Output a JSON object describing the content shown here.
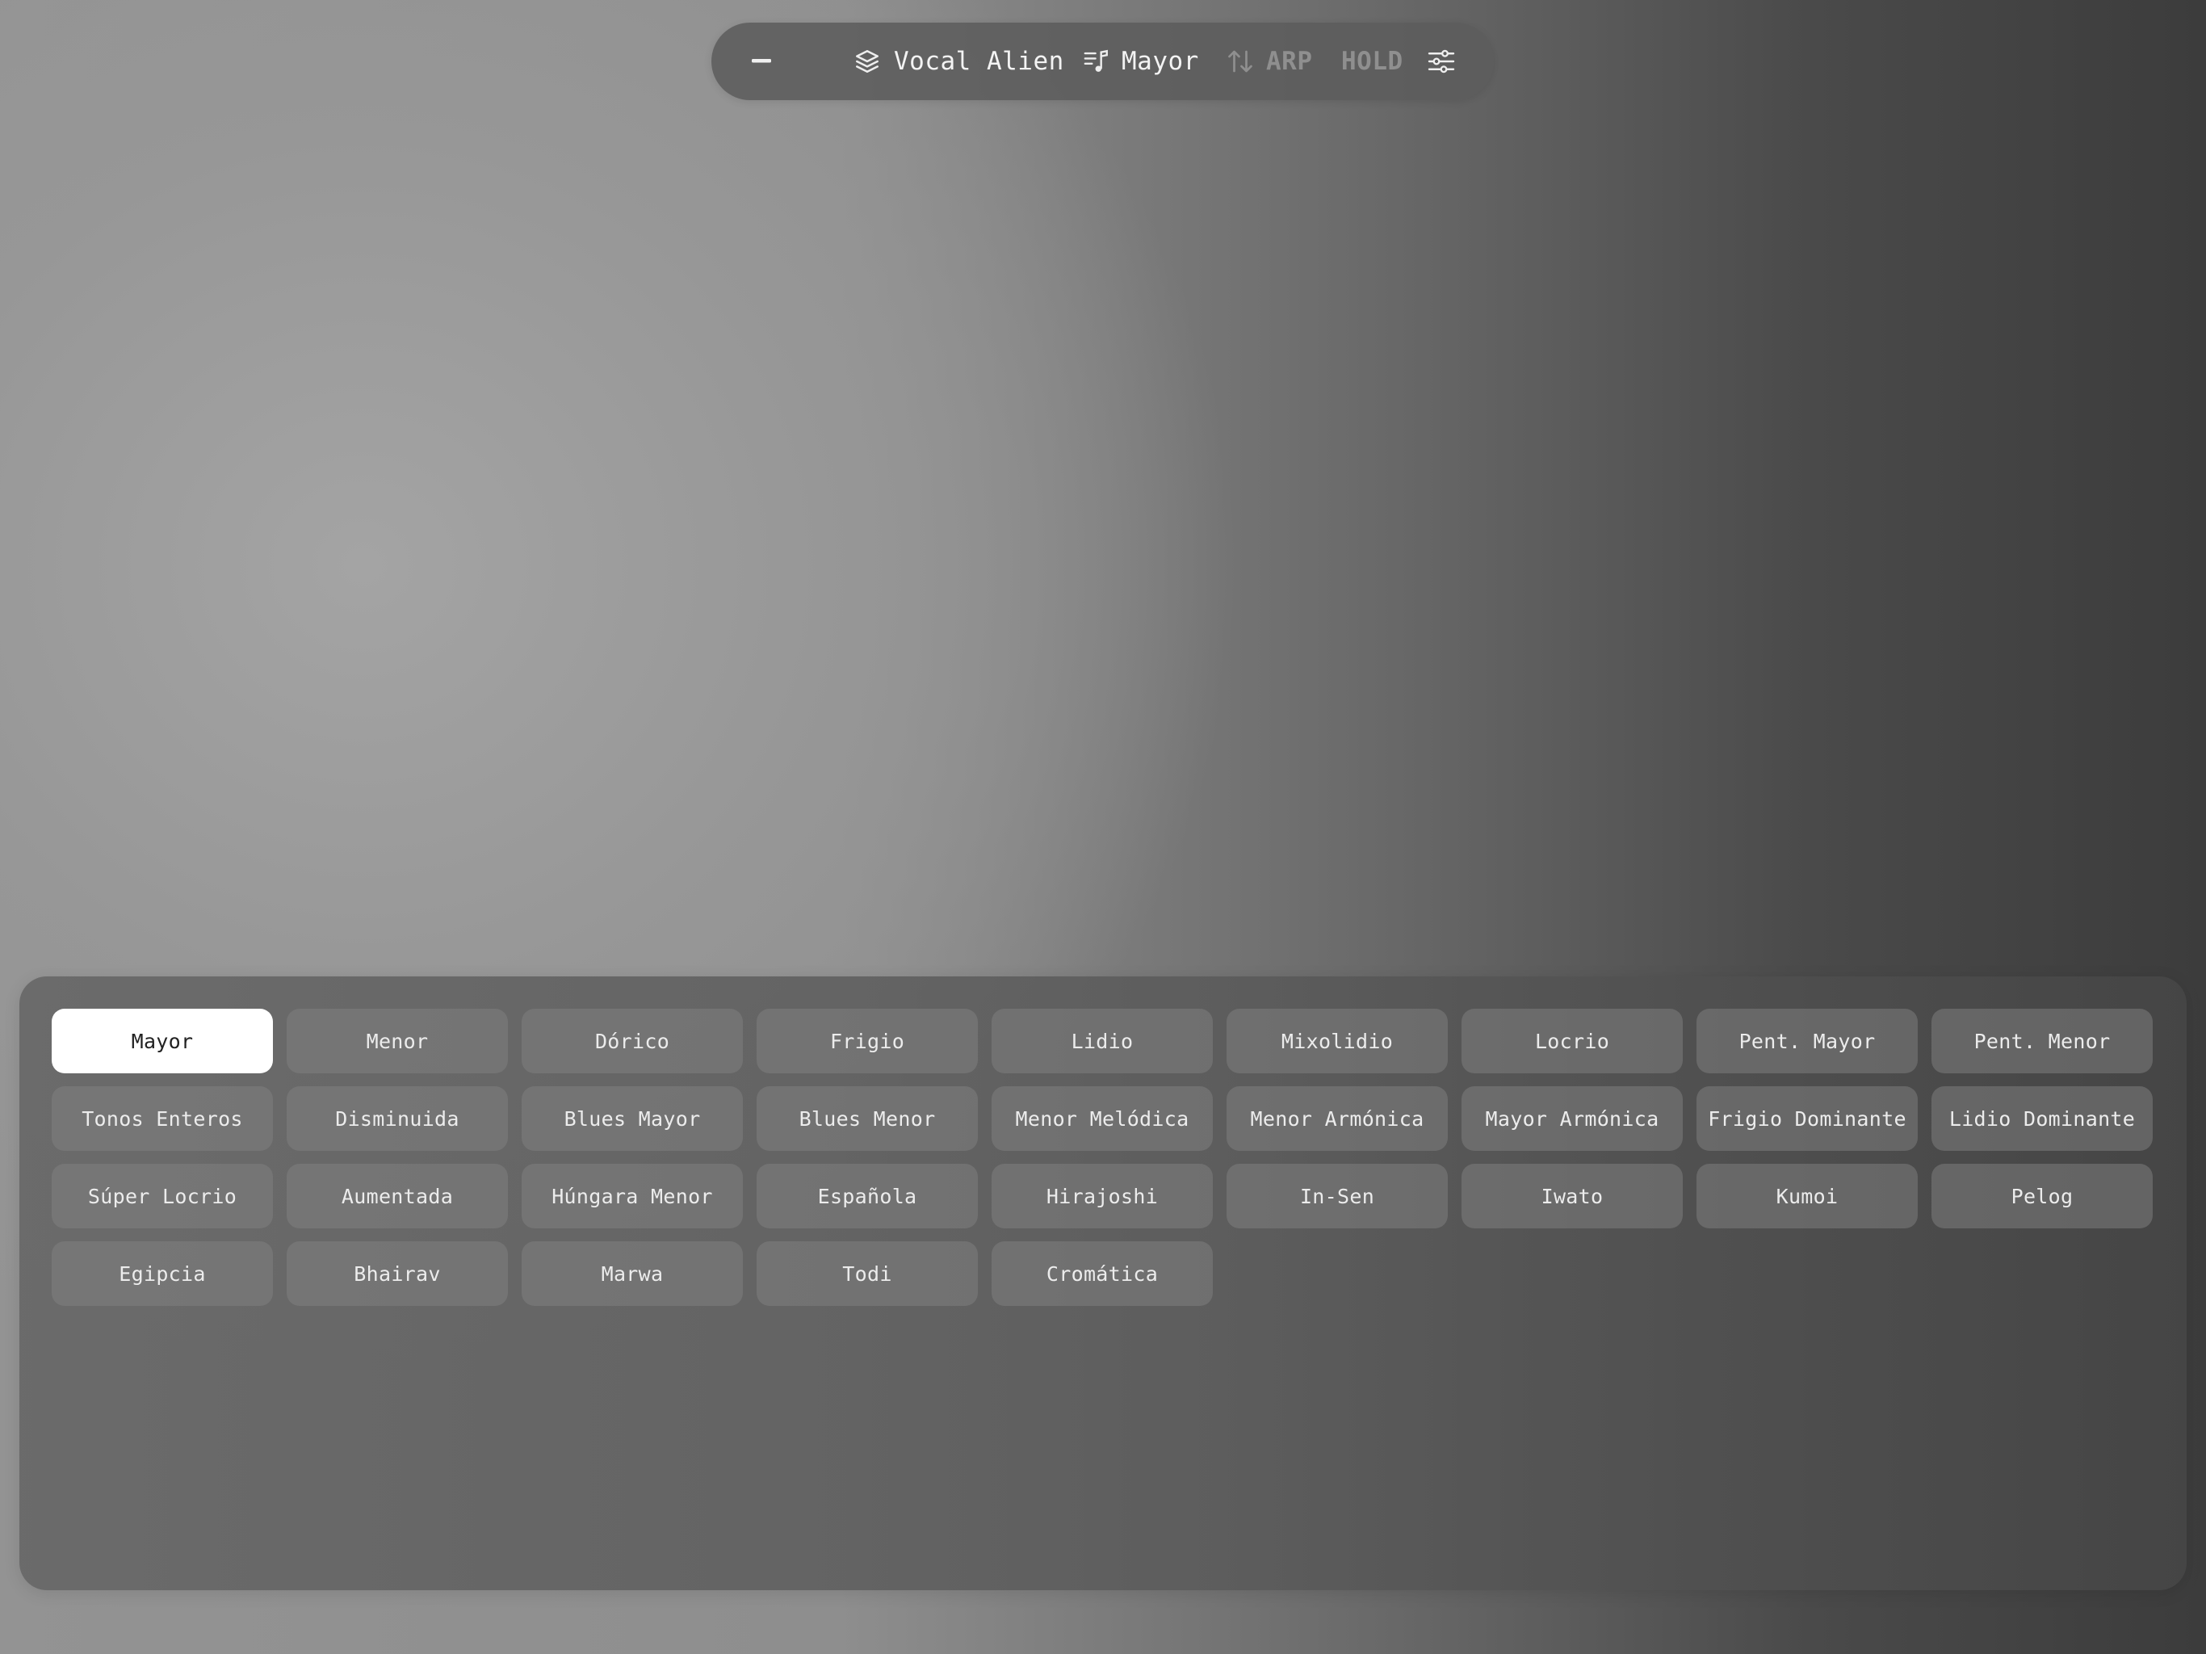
{
  "toolbar": {
    "minimize_icon": "minus-icon",
    "preset": {
      "icon": "layers-icon",
      "label": "Vocal Alien"
    },
    "scale": {
      "icon": "music-list-icon",
      "label": "Mayor"
    },
    "arp": {
      "icon": "arrows-up-down-icon",
      "label": "ARP",
      "active": false
    },
    "hold": {
      "label": "HOLD",
      "active": false
    },
    "settings_icon": "sliders-icon"
  },
  "scale_panel": {
    "selected": "Mayor",
    "scales": [
      "Mayor",
      "Menor",
      "Dórico",
      "Frigio",
      "Lidio",
      "Mixolidio",
      "Locrio",
      "Pent. Mayor",
      "Pent. Menor",
      "Tonos Enteros",
      "Disminuida",
      "Blues Mayor",
      "Blues Menor",
      "Menor Melódica",
      "Menor Armónica",
      "Mayor Armónica",
      "Frigio Dominante",
      "Lidio Dominante",
      "Súper Locrio",
      "Aumentada",
      "Húngara Menor",
      "Española",
      "Hirajoshi",
      "In-Sen",
      "Iwato",
      "Kumoi",
      "Pelog",
      "Egipcia",
      "Bhairav",
      "Marwa",
      "Todi",
      "Cromática"
    ]
  },
  "colors": {
    "toolbar_bg": "#5c5c5c",
    "selected_bg": "#ffffff",
    "button_bg": "#7a7a7a",
    "inactive_text": "#8f8f8f"
  }
}
